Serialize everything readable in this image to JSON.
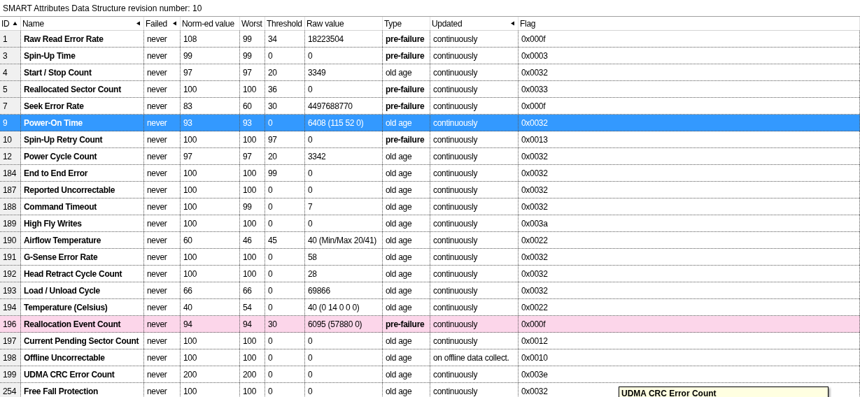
{
  "title": "SMART Attributes Data Structure revision number: 10",
  "table": {
    "columns": [
      {
        "label": "ID",
        "sorted": true,
        "arrow": false
      },
      {
        "label": "Name",
        "sorted": false,
        "arrow": true
      },
      {
        "label": "Failed",
        "sorted": false,
        "arrow": true
      },
      {
        "label": "Norm-ed value",
        "sorted": false,
        "arrow": false
      },
      {
        "label": "Worst",
        "sorted": false,
        "arrow": false
      },
      {
        "label": "Threshold",
        "sorted": false,
        "arrow": false
      },
      {
        "label": "Raw value",
        "sorted": false,
        "arrow": false
      },
      {
        "label": "Type",
        "sorted": false,
        "arrow": false
      },
      {
        "label": "Updated",
        "sorted": false,
        "arrow": true
      },
      {
        "label": "Flag",
        "sorted": false,
        "arrow": false
      }
    ],
    "rows": [
      {
        "id": "1",
        "name": "Raw Read Error Rate",
        "failed": "never",
        "value": "108",
        "worst": "99",
        "threshold": "34",
        "raw": "18223504",
        "type": "pre-failure",
        "prefailure": true,
        "updated": "continuously",
        "flag": "0x000f",
        "selected": false,
        "warning": false
      },
      {
        "id": "3",
        "name": "Spin-Up Time",
        "failed": "never",
        "value": "99",
        "worst": "99",
        "threshold": "0",
        "raw": "0",
        "type": "pre-failure",
        "prefailure": true,
        "updated": "continuously",
        "flag": "0x0003",
        "selected": false,
        "warning": false
      },
      {
        "id": "4",
        "name": "Start / Stop Count",
        "failed": "never",
        "value": "97",
        "worst": "97",
        "threshold": "20",
        "raw": "3349",
        "type": "old age",
        "prefailure": false,
        "updated": "continuously",
        "flag": "0x0032",
        "selected": false,
        "warning": false
      },
      {
        "id": "5",
        "name": "Reallocated Sector Count",
        "failed": "never",
        "value": "100",
        "worst": "100",
        "threshold": "36",
        "raw": "0",
        "type": "pre-failure",
        "prefailure": true,
        "updated": "continuously",
        "flag": "0x0033",
        "selected": false,
        "warning": false
      },
      {
        "id": "7",
        "name": "Seek Error Rate",
        "failed": "never",
        "value": "83",
        "worst": "60",
        "threshold": "30",
        "raw": "4497688770",
        "type": "pre-failure",
        "prefailure": true,
        "updated": "continuously",
        "flag": "0x000f",
        "selected": false,
        "warning": false
      },
      {
        "id": "9",
        "name": "Power-On Time",
        "failed": "never",
        "value": "93",
        "worst": "93",
        "threshold": "0",
        "raw": "6408 (115 52 0)",
        "type": "old age",
        "prefailure": false,
        "updated": "continuously",
        "flag": "0x0032",
        "selected": true,
        "warning": false
      },
      {
        "id": "10",
        "name": "Spin-Up Retry Count",
        "failed": "never",
        "value": "100",
        "worst": "100",
        "threshold": "97",
        "raw": "0",
        "type": "pre-failure",
        "prefailure": true,
        "updated": "continuously",
        "flag": "0x0013",
        "selected": false,
        "warning": false
      },
      {
        "id": "12",
        "name": "Power Cycle Count",
        "failed": "never",
        "value": "97",
        "worst": "97",
        "threshold": "20",
        "raw": "3342",
        "type": "old age",
        "prefailure": false,
        "updated": "continuously",
        "flag": "0x0032",
        "selected": false,
        "warning": false
      },
      {
        "id": "184",
        "name": "End to End Error",
        "failed": "never",
        "value": "100",
        "worst": "100",
        "threshold": "99",
        "raw": "0",
        "type": "old age",
        "prefailure": false,
        "updated": "continuously",
        "flag": "0x0032",
        "selected": false,
        "warning": false
      },
      {
        "id": "187",
        "name": "Reported Uncorrectable",
        "failed": "never",
        "value": "100",
        "worst": "100",
        "threshold": "0",
        "raw": "0",
        "type": "old age",
        "prefailure": false,
        "updated": "continuously",
        "flag": "0x0032",
        "selected": false,
        "warning": false
      },
      {
        "id": "188",
        "name": "Command Timeout",
        "failed": "never",
        "value": "100",
        "worst": "99",
        "threshold": "0",
        "raw": "7",
        "type": "old age",
        "prefailure": false,
        "updated": "continuously",
        "flag": "0x0032",
        "selected": false,
        "warning": false
      },
      {
        "id": "189",
        "name": "High Fly Writes",
        "failed": "never",
        "value": "100",
        "worst": "100",
        "threshold": "0",
        "raw": "0",
        "type": "old age",
        "prefailure": false,
        "updated": "continuously",
        "flag": "0x003a",
        "selected": false,
        "warning": false
      },
      {
        "id": "190",
        "name": "Airflow Temperature",
        "failed": "never",
        "value": "60",
        "worst": "46",
        "threshold": "45",
        "raw": "40 (Min/Max 20/41)",
        "type": "old age",
        "prefailure": false,
        "updated": "continuously",
        "flag": "0x0022",
        "selected": false,
        "warning": false
      },
      {
        "id": "191",
        "name": "G-Sense Error Rate",
        "failed": "never",
        "value": "100",
        "worst": "100",
        "threshold": "0",
        "raw": "58",
        "type": "old age",
        "prefailure": false,
        "updated": "continuously",
        "flag": "0x0032",
        "selected": false,
        "warning": false
      },
      {
        "id": "192",
        "name": "Head Retract Cycle Count",
        "failed": "never",
        "value": "100",
        "worst": "100",
        "threshold": "0",
        "raw": "28",
        "type": "old age",
        "prefailure": false,
        "updated": "continuously",
        "flag": "0x0032",
        "selected": false,
        "warning": false
      },
      {
        "id": "193",
        "name": "Load / Unload Cycle",
        "failed": "never",
        "value": "66",
        "worst": "66",
        "threshold": "0",
        "raw": "69866",
        "type": "old age",
        "prefailure": false,
        "updated": "continuously",
        "flag": "0x0032",
        "selected": false,
        "warning": false
      },
      {
        "id": "194",
        "name": "Temperature (Celsius)",
        "failed": "never",
        "value": "40",
        "worst": "54",
        "threshold": "0",
        "raw": "40 (0 14 0 0 0)",
        "type": "old age",
        "prefailure": false,
        "updated": "continuously",
        "flag": "0x0022",
        "selected": false,
        "warning": false
      },
      {
        "id": "196",
        "name": "Reallocation Event Count",
        "failed": "never",
        "value": "94",
        "worst": "94",
        "threshold": "30",
        "raw": "6095 (57880 0)",
        "type": "pre-failure",
        "prefailure": true,
        "updated": "continuously",
        "flag": "0x000f",
        "selected": false,
        "warning": true
      },
      {
        "id": "197",
        "name": "Current Pending Sector Count",
        "failed": "never",
        "value": "100",
        "worst": "100",
        "threshold": "0",
        "raw": "0",
        "type": "old age",
        "prefailure": false,
        "updated": "continuously",
        "flag": "0x0012",
        "selected": false,
        "warning": false
      },
      {
        "id": "198",
        "name": "Offline Uncorrectable",
        "failed": "never",
        "value": "100",
        "worst": "100",
        "threshold": "0",
        "raw": "0",
        "type": "old age",
        "prefailure": false,
        "updated": "on offline data collect.",
        "flag": "0x0010",
        "selected": false,
        "warning": false
      },
      {
        "id": "199",
        "name": "UDMA CRC Error Count",
        "failed": "never",
        "value": "200",
        "worst": "200",
        "threshold": "0",
        "raw": "0",
        "type": "old age",
        "prefailure": false,
        "updated": "continuously",
        "flag": "0x003e",
        "selected": false,
        "warning": false
      },
      {
        "id": "254",
        "name": "Free Fall Protection",
        "failed": "never",
        "value": "100",
        "worst": "100",
        "threshold": "0",
        "raw": "0",
        "type": "old age",
        "prefailure": false,
        "updated": "continuously",
        "flag": "0x0032",
        "selected": false,
        "warning": false
      }
    ]
  },
  "tooltip": {
    "text": "UDMA CRC Error Count"
  }
}
